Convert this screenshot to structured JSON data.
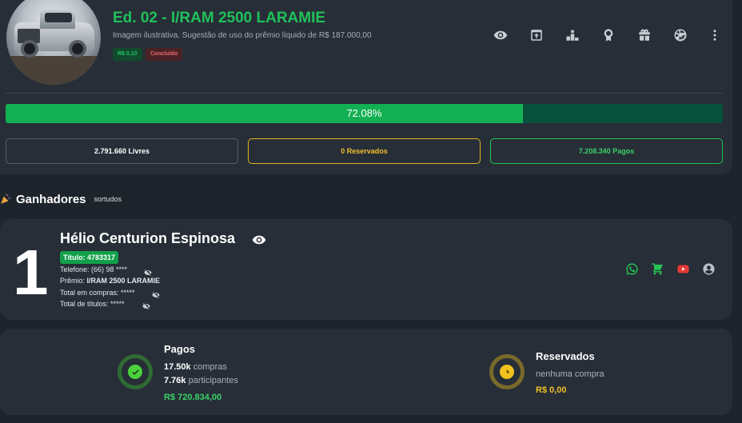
{
  "raffle": {
    "title": "Ed. 02 - I/RAM 2500 LARAMIE",
    "subtitle": "Imagem ilustrativa. Sugestão de uso do prêmio líquido de R$ 187.000,00",
    "price_badge": "R$ 0,10",
    "status_badge": "Concluído",
    "progress_percent": 72.08,
    "progress_label": "72.08%",
    "stats": {
      "free": "2.791.660 Livres",
      "reserved": "0 Reservados",
      "paid": "7.208.340 Pagos"
    },
    "toolbar_icons": [
      "eye-icon",
      "share-icon",
      "podium-icon",
      "award-icon",
      "gift-icon",
      "wheel-icon",
      "more-vert-icon"
    ]
  },
  "winners": {
    "title": "Ganhadores",
    "subtitle": "sortudos",
    "list": [
      {
        "rank": "1",
        "name": "Hélio Centurion Espinosa",
        "ticket": "Título: 4783317",
        "phone": "Telefone: (66) 98 ****",
        "prize_label": "Prêmio:",
        "prize": "I/RAM 2500 LARAMIE",
        "total_purchases": "Total em compras: *****",
        "total_titles": "Total de títulos: *****",
        "contact_icons": [
          "whatsapp-icon",
          "cart-icon",
          "youtube-icon",
          "user-icon"
        ]
      }
    ]
  },
  "summary": {
    "paid": {
      "title": "Pagos",
      "purchases_value": "17.50k",
      "purchases_label": "compras",
      "participants_value": "7.76k",
      "participants_label": "participantes",
      "amount": "R$ 720.834,00"
    },
    "reserved": {
      "title": "Reservados",
      "line": "nenhuma compra",
      "amount": "R$ 0,00"
    }
  },
  "colors": {
    "accent_green": "#1fc15b",
    "reserved_yellow": "#f0c02a",
    "card_bg": "#272e37",
    "page_bg": "#1e242c"
  }
}
